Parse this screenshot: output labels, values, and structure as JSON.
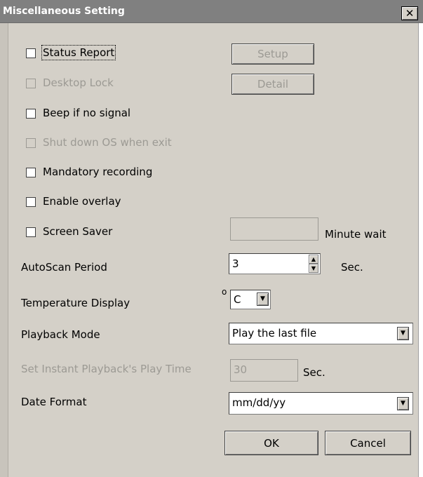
{
  "window": {
    "title": "Miscellaneous Setting",
    "close_glyph": "✕"
  },
  "options": {
    "status_report": "Status Report",
    "desktop_lock": "Desktop Lock",
    "beep_no_signal": "Beep if no signal",
    "shutdown_os": "Shut down OS when exit",
    "mandatory_recording": "Mandatory recording",
    "enable_overlay": "Enable overlay",
    "screen_saver": "Screen Saver"
  },
  "buttons": {
    "setup": "Setup",
    "detail": "Detail",
    "ok": "OK",
    "cancel": "Cancel"
  },
  "screen_saver": {
    "value": "",
    "unit": "Minute wait"
  },
  "autoscan": {
    "label": "AutoScan Period",
    "value": "3",
    "unit": "Sec.",
    "up_icon": "▲",
    "down_icon": "▼"
  },
  "temperature": {
    "label": "Temperature Display",
    "degree": "o",
    "value": "C",
    "dropdown_icon": "▼"
  },
  "playback": {
    "label": "Playback Mode",
    "value": "Play the last file",
    "dropdown_icon": "▼"
  },
  "instant_playback": {
    "label": "Set Instant Playback's Play Time",
    "value": "30",
    "unit": "Sec."
  },
  "date_format": {
    "label": "Date Format",
    "value": "mm/dd/yy",
    "dropdown_icon": "▼"
  }
}
